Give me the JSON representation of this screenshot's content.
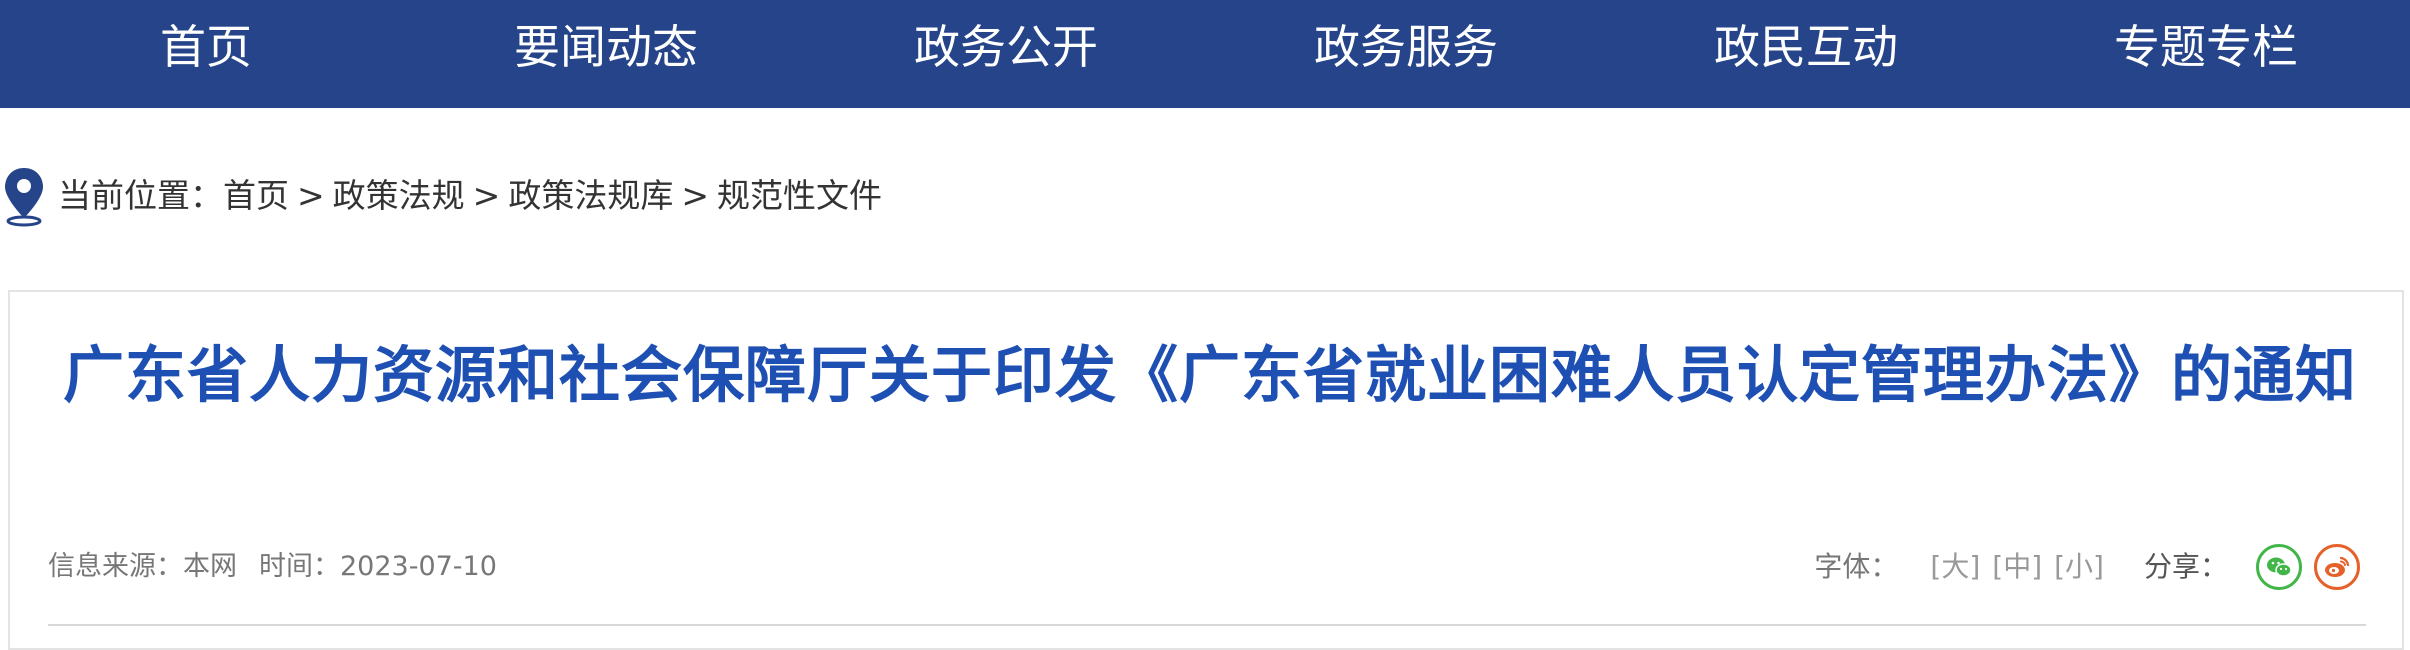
{
  "nav": {
    "items": [
      {
        "label": "首页"
      },
      {
        "label": "要闻动态"
      },
      {
        "label": "政务公开"
      },
      {
        "label": "政务服务"
      },
      {
        "label": "政民互动"
      },
      {
        "label": "专题专栏"
      }
    ]
  },
  "breadcrumb": {
    "prefix": "当前位置：",
    "items": [
      "首页",
      "政策法规",
      "政策法规库",
      "规范性文件"
    ],
    "separator": ">"
  },
  "article": {
    "title": "广东省人力资源和社会保障厅关于印发《广东省就业困难人员认定管理办法》的通知",
    "source_label": "信息来源：",
    "source_value": "本网",
    "time_label": "时间：",
    "time_value": "2023-07-10",
    "font_label": "字体：",
    "font_sizes": [
      "[大]",
      "[中]",
      "[小]"
    ],
    "share_label": "分享："
  },
  "colors": {
    "nav_bg": "#254489",
    "title": "#1e4fb3",
    "wechat": "#43b649",
    "weibo": "#e6612a"
  },
  "icons": {
    "location": "map-pin-icon",
    "wechat": "wechat-icon",
    "weibo": "weibo-icon"
  }
}
